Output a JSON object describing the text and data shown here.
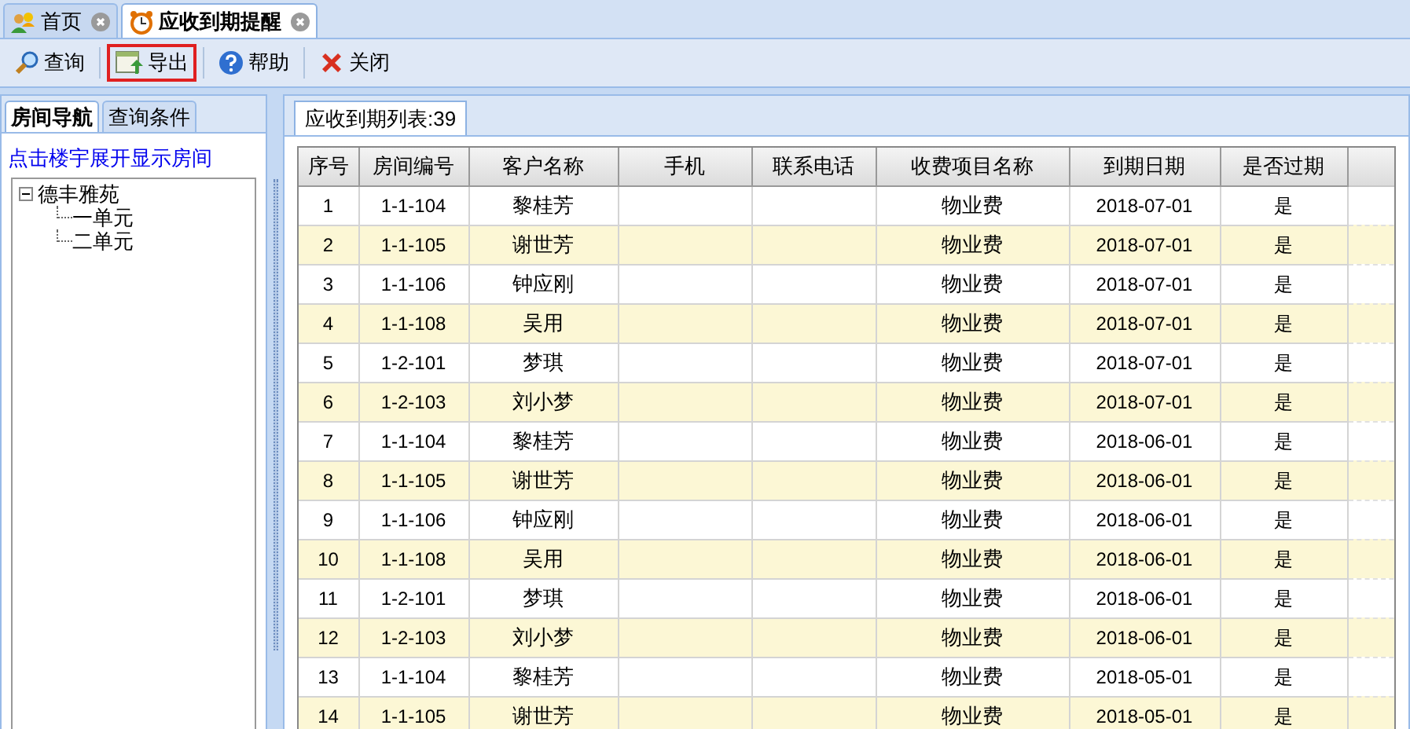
{
  "tabs": [
    {
      "label": "首页",
      "selected": false
    },
    {
      "label": "应收到期提醒",
      "selected": true
    }
  ],
  "toolbar": [
    {
      "label": "查询",
      "highlighted": false
    },
    {
      "label": "导出",
      "highlighted": true
    },
    {
      "label": "帮助",
      "highlighted": false
    },
    {
      "label": "关闭",
      "highlighted": false
    }
  ],
  "left_tabs": [
    {
      "label": "房间导航",
      "selected": true
    },
    {
      "label": "查询条件",
      "selected": false
    }
  ],
  "hint": "点击楼宇展开显示房间",
  "tree": [
    {
      "label": "德丰雅苑",
      "expanded": true,
      "children": [
        {
          "label": "一单元"
        },
        {
          "label": "二单元"
        }
      ]
    }
  ],
  "list_tab": "应收到期列表:39",
  "table": {
    "columns": [
      "序号",
      "房间编号",
      "客户名称",
      "手机",
      "联系电话",
      "收费项目名称",
      "到期日期",
      "是否过期"
    ],
    "rows": [
      [
        "1",
        "1-1-104",
        "黎桂芳",
        "",
        "",
        "物业费",
        "2018-07-01",
        "是"
      ],
      [
        "2",
        "1-1-105",
        "谢世芳",
        "",
        "",
        "物业费",
        "2018-07-01",
        "是"
      ],
      [
        "3",
        "1-1-106",
        "钟应刚",
        "",
        "",
        "物业费",
        "2018-07-01",
        "是"
      ],
      [
        "4",
        "1-1-108",
        "吴用",
        "",
        "",
        "物业费",
        "2018-07-01",
        "是"
      ],
      [
        "5",
        "1-2-101",
        "梦琪",
        "",
        "",
        "物业费",
        "2018-07-01",
        "是"
      ],
      [
        "6",
        "1-2-103",
        "刘小梦",
        "",
        "",
        "物业费",
        "2018-07-01",
        "是"
      ],
      [
        "7",
        "1-1-104",
        "黎桂芳",
        "",
        "",
        "物业费",
        "2018-06-01",
        "是"
      ],
      [
        "8",
        "1-1-105",
        "谢世芳",
        "",
        "",
        "物业费",
        "2018-06-01",
        "是"
      ],
      [
        "9",
        "1-1-106",
        "钟应刚",
        "",
        "",
        "物业费",
        "2018-06-01",
        "是"
      ],
      [
        "10",
        "1-1-108",
        "吴用",
        "",
        "",
        "物业费",
        "2018-06-01",
        "是"
      ],
      [
        "11",
        "1-2-101",
        "梦琪",
        "",
        "",
        "物业费",
        "2018-06-01",
        "是"
      ],
      [
        "12",
        "1-2-103",
        "刘小梦",
        "",
        "",
        "物业费",
        "2018-06-01",
        "是"
      ],
      [
        "13",
        "1-1-104",
        "黎桂芳",
        "",
        "",
        "物业费",
        "2018-05-01",
        "是"
      ],
      [
        "14",
        "1-1-105",
        "谢世芳",
        "",
        "",
        "物业费",
        "2018-05-01",
        "是"
      ]
    ]
  }
}
